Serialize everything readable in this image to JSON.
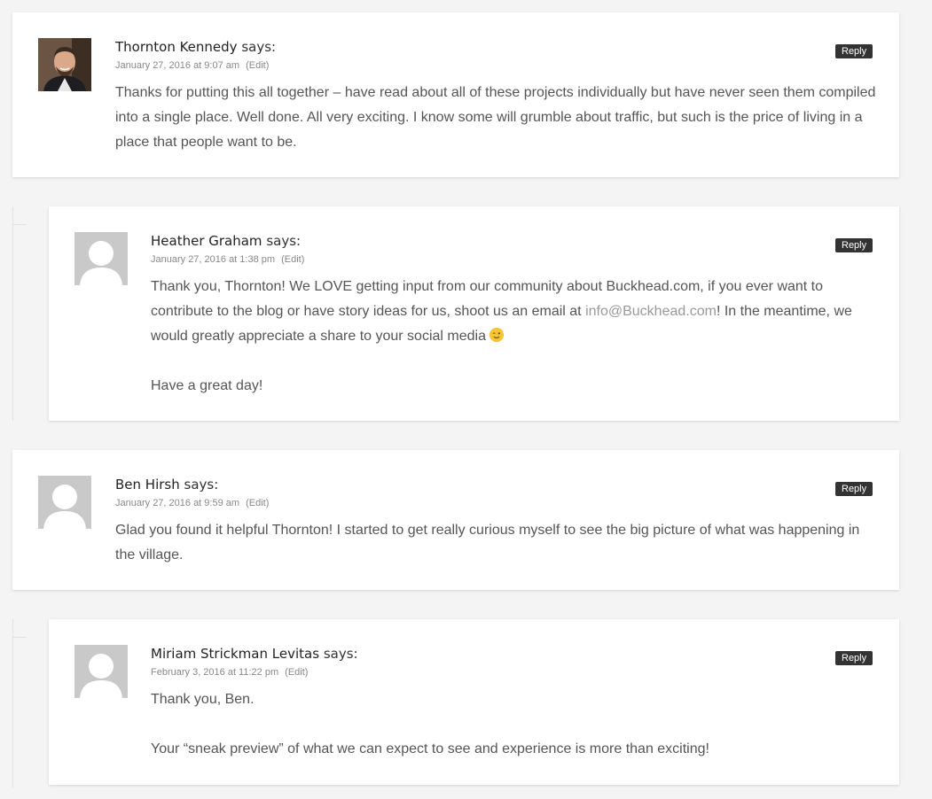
{
  "comments": [
    {
      "author": "Thornton Kennedy",
      "says": "says:",
      "date": "January 27, 2016 at 9:07 am",
      "edit": "(Edit)",
      "reply": "Reply",
      "avatar": "photo-avatar",
      "body": "Thanks for putting this all together – have read about all of these projects individually but have never seen them compiled into a single place. Well done. All very exciting. I know some will grumble about traffic, but such is the price of living in a place that people want to be."
    },
    {
      "author": "Heather Graham",
      "says": "says:",
      "date": "January 27, 2016 at 1:38 pm",
      "edit": "(Edit)",
      "reply": "Reply",
      "avatar": "default-avatar",
      "body_part1": "Thank you, Thornton! We LOVE getting input from our community about Buckhead.com, if you ever want to contribute to the blog or have story ideas for us, shoot us an email at ",
      "email": "info@Buckhead.com",
      "body_part2": "! In the meantime, we would greatly appreciate a share to your social media ",
      "emoji": "wink-emoji",
      "body_p2": "Have a great day!"
    },
    {
      "author": "Ben Hirsh",
      "says": "says:",
      "date": "January 27, 2016 at 9:59 am",
      "edit": "(Edit)",
      "reply": "Reply",
      "avatar": "default-avatar",
      "body": "Glad you found it helpful Thornton! I started to get really curious myself to see the big picture of what was happening in the village."
    },
    {
      "author": "Miriam Strickman Levitas",
      "says": "says:",
      "date": "February 3, 2016 at 11:22 pm",
      "edit": "(Edit)",
      "reply": "Reply",
      "avatar": "default-avatar",
      "body_p1": "Thank you, Ben.",
      "body_p2": "Your “sneak preview” of what we can expect to see and experience is more than exciting!"
    }
  ],
  "colors": {
    "background": "#f4f4f4",
    "card": "#ffffff",
    "reply_button": "#333333",
    "link": "#999999"
  }
}
